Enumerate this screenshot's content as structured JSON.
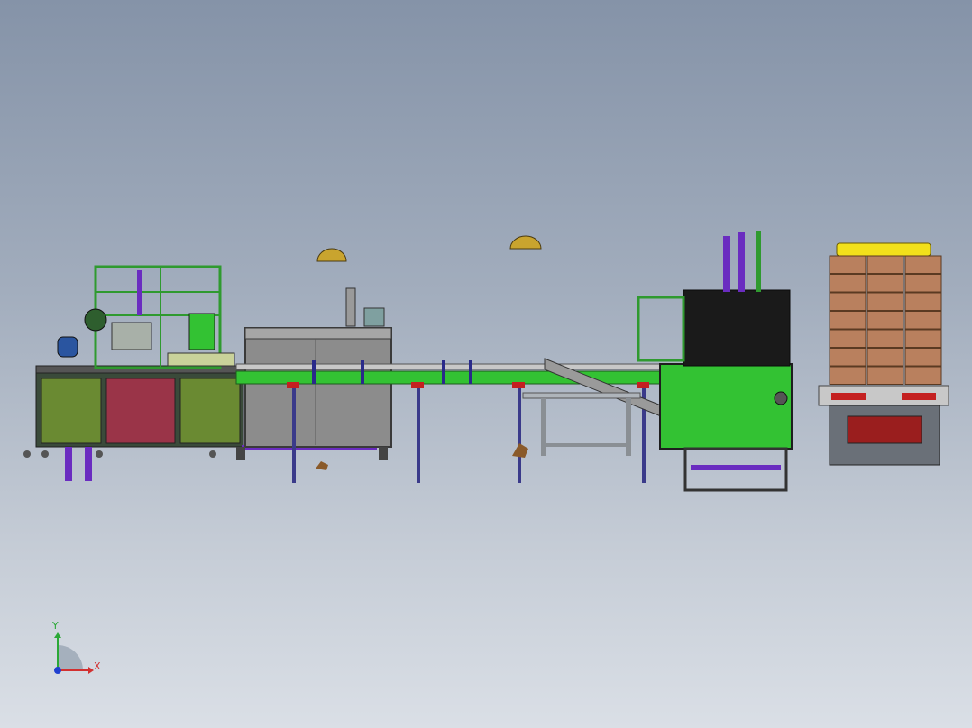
{
  "viewport": {
    "background_top": "#8593a8",
    "background_bottom": "#dadfe6"
  },
  "triad": {
    "x_label": "X",
    "y_label": "Y",
    "x_color": "#d23030",
    "y_color": "#2aa836",
    "z_color": "#2040d0"
  },
  "palette": {
    "frame_green": "#2f9a2f",
    "panel_olive": "#6a8a32",
    "panel_maroon": "#9a3448",
    "steel_gray": "#8c8c8c",
    "conveyor_green": "#33c233",
    "cabinet_black": "#1a1a1a",
    "carton_brown": "#b9805e",
    "pallet_yellow": "#f2e01b",
    "purple_part": "#6a2cc0",
    "red_part": "#c42020"
  }
}
